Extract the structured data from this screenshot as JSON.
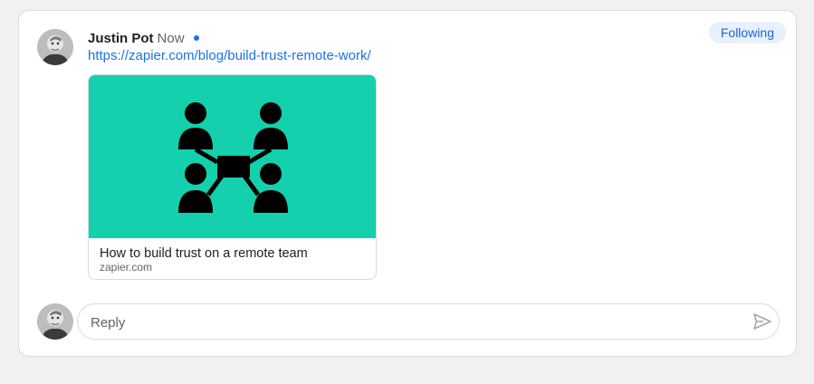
{
  "post": {
    "author": "Justin Pot",
    "time": "Now",
    "link_text": "https://zapier.com/blog/build-trust-remote-work/",
    "follow_label": "Following"
  },
  "link_preview": {
    "title": "How to build trust on a remote team",
    "domain": "zapier.com",
    "image_bg": "#14d0ac",
    "image_icon": "network-of-people-icon"
  },
  "reply": {
    "placeholder": "Reply",
    "send_icon": "send-icon"
  },
  "colors": {
    "accent": "#1a73e8",
    "chip_bg": "#e8f0fe"
  }
}
